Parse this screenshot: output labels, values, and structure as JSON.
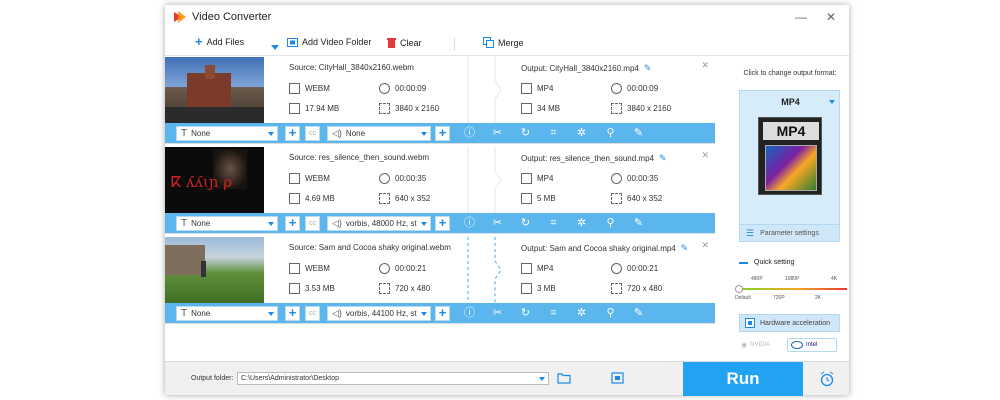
{
  "window": {
    "title": "Video Converter",
    "minimize": "—",
    "close": "✕"
  },
  "toolbar": {
    "add_files": "Add Files",
    "add_video_folder": "Add Video Folder",
    "clear": "Clear",
    "merge": "Merge"
  },
  "tasks": [
    {
      "source": "Source: CityHall_3840x2160.webm",
      "src_format": "WEBM",
      "src_duration": "00:00:09",
      "src_size": "17.94 MB",
      "src_resolution": "3840 x 2160",
      "output": "Output: CityHall_3840x2160.mp4",
      "out_format": "MP4",
      "out_duration": "00:00:09",
      "out_size": "34 MB",
      "out_resolution": "3840 x 2160",
      "subtitle": "None",
      "audio": "None"
    },
    {
      "source": "Source: res_silence_then_sound.webm",
      "src_format": "WEBM",
      "src_duration": "00:00:35",
      "src_size": "4.69 MB",
      "src_resolution": "640 x 352",
      "output": "Output: res_silence_then_sound.mp4",
      "out_format": "MP4",
      "out_duration": "00:00:35",
      "out_size": "5 MB",
      "out_resolution": "640 x 352",
      "subtitle": "None",
      "audio": "vorbis, 48000 Hz, st"
    },
    {
      "source": "Source: Sam and Cocoa shaky original.webm",
      "src_format": "WEBM",
      "src_duration": "00:00:21",
      "src_size": "3.53 MB",
      "src_resolution": "720 x 480",
      "output": "Output: Sam and Cocoa shaky original.mp4",
      "out_format": "MP4",
      "out_duration": "00:00:21",
      "out_size": "3 MB",
      "out_resolution": "720 x 480",
      "subtitle": "None",
      "audio": "vorbis, 44100 Hz, st"
    }
  ],
  "thumb2_text": "ⴽ ʎʎɩɲ ρ",
  "right_panel": {
    "hint": "Click to change output format:",
    "format": "MP4",
    "format_icon_text": "MP4",
    "parameter_settings": "Parameter settings",
    "quick_setting": "Quick setting",
    "q_top": [
      "480P",
      "1080P",
      "4K"
    ],
    "q_bottom": [
      "Default",
      "720P",
      "2K"
    ],
    "hw_accel": "Hardware acceleration",
    "nvidia": "NVIDIA",
    "intel": "Intel"
  },
  "bottom": {
    "output_folder_label": "Output folder:",
    "output_folder_value": "C:\\Users\\Administrator\\Desktop",
    "run": "Run"
  },
  "colors": {
    "accent": "#21a3f2",
    "bar": "#5bb6ee",
    "pen": "#1e88e5"
  }
}
